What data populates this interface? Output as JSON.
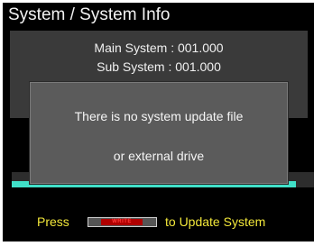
{
  "header": {
    "title": "System / System Info"
  },
  "info": {
    "main_system": "Main System : 001.000",
    "sub_system": "Sub System : 001.000"
  },
  "progress": {
    "fraction": 0.93,
    "color": "#40e0c8"
  },
  "dialog": {
    "line1": "There is no system update file",
    "line2": "or external drive"
  },
  "prompt": {
    "press": "Press",
    "key_label": "WRITE",
    "rest": "to Update System",
    "text_color": "#f3e83a",
    "key_color": "#b00000"
  }
}
